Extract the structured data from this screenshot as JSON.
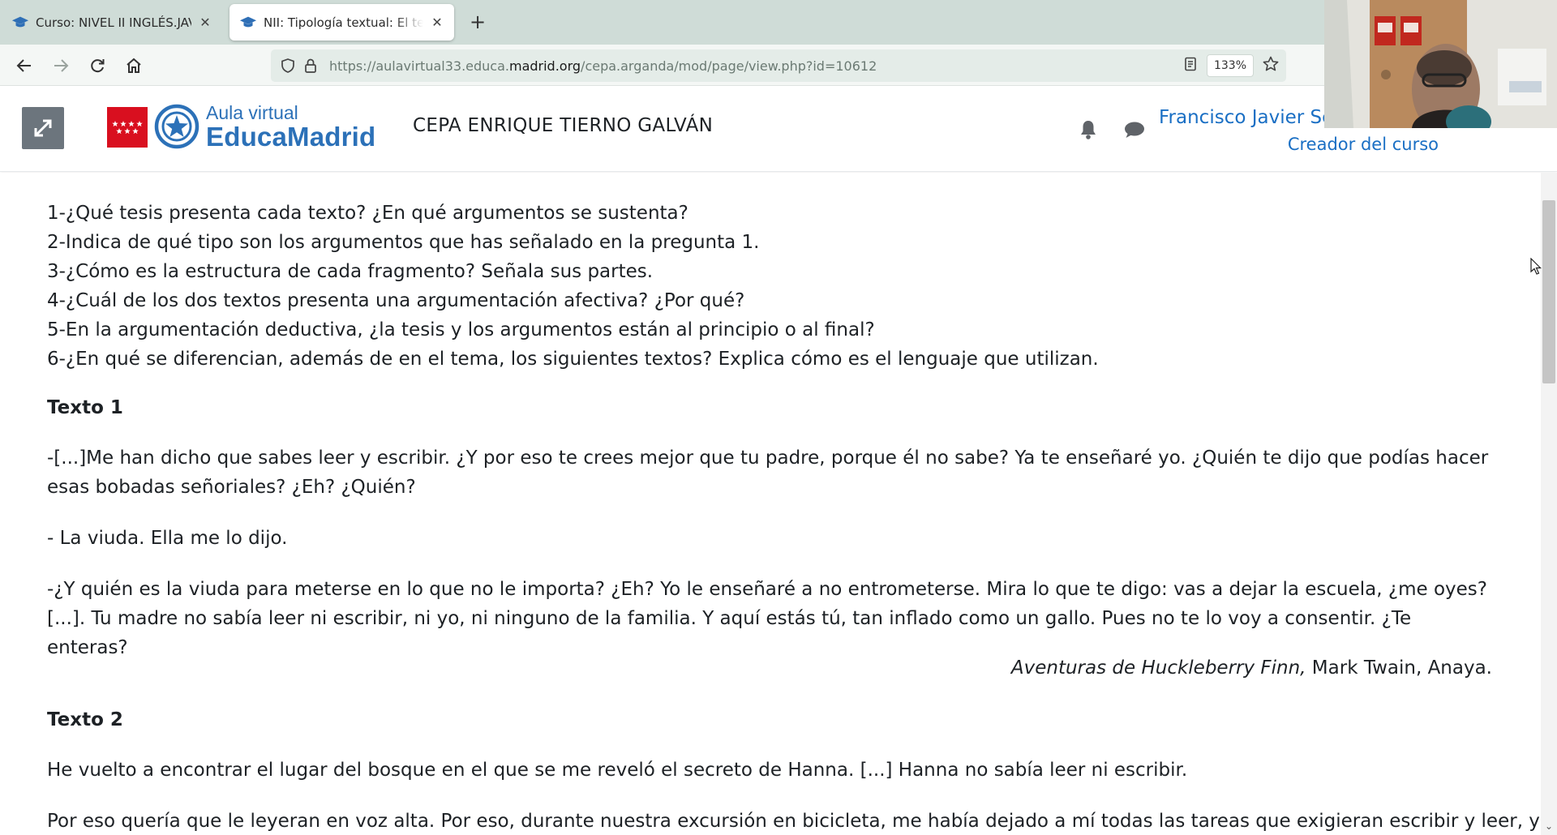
{
  "browser": {
    "tabs": [
      {
        "label": "Curso: NIVEL II INGLÉS.JAVIER",
        "active": false
      },
      {
        "label": "NII: Tipología textual: El texto argumentativo",
        "active": true
      }
    ],
    "url": {
      "prefix": "https://aulavirtual33.educa.",
      "domain": "madrid.org",
      "path": "/cepa.arganda/mod/page/view.php?id=10612"
    },
    "zoom": "133%"
  },
  "header": {
    "logo_small": "Aula virtual",
    "logo_big": "EducaMadrid",
    "site_name": "CEPA ENRIQUE TIERNO GALVÁN",
    "user_name": "Francisco Javier Se",
    "user_role": "Creador del curso"
  },
  "content": {
    "questions": [
      "1-¿Qué tesis presenta cada texto? ¿En qué argumentos se sustenta?",
      "2-Indica de qué tipo son los argumentos que has señalado en la pregunta 1.",
      "3-¿Cómo es la estructura de cada fragmento? Señala sus partes.",
      "4-¿Cuál de los dos textos presenta una argumentación afectiva? ¿Por qué?",
      "5-En la argumentación deductiva, ¿la tesis y los argumentos están al principio o al final?",
      "6-¿En qué se diferencian, además de en el tema, los siguientes textos? Explica cómo es el lenguaje que utilizan."
    ],
    "texto1": {
      "title": "Texto 1",
      "p1": "-[...]Me han dicho que sabes leer y escribir. ¿Y por eso te crees mejor que tu padre, porque él no sabe? Ya te enseñaré yo. ¿Quién te dijo que podías hacer esas bobadas señoriales? ¿Eh? ¿Quién?",
      "p2": "- La viuda. Ella me lo dijo.",
      "p3": "-¿Y quién es la viuda para meterse en lo que no le importa? ¿Eh? Yo le enseñaré a no entrometerse. Mira lo que te digo: vas a dejar la escuela, ¿me oyes? [...]. Tu madre no sabía leer ni escribir, ni yo, ni ninguno de la familia. Y aquí estás tú, tan inflado como un gallo. Pues no te lo voy a consentir. ¿Te enteras?",
      "citation_title": "Aventuras de Huckleberry Finn,",
      "citation_rest": " Mark Twain, Anaya."
    },
    "texto2": {
      "title": "Texto 2",
      "p1": "He vuelto a encontrar el lugar del bosque en el que se me reveló el secreto de Hanna. [...] Hanna no sabía leer ni escribir.",
      "p2": "Por eso quería que le leyeran en voz alta. Por eso, durante nuestra excursión en bicicleta, me había dejado a mí todas las tareas que exigieran escribir y leer, y"
    }
  }
}
